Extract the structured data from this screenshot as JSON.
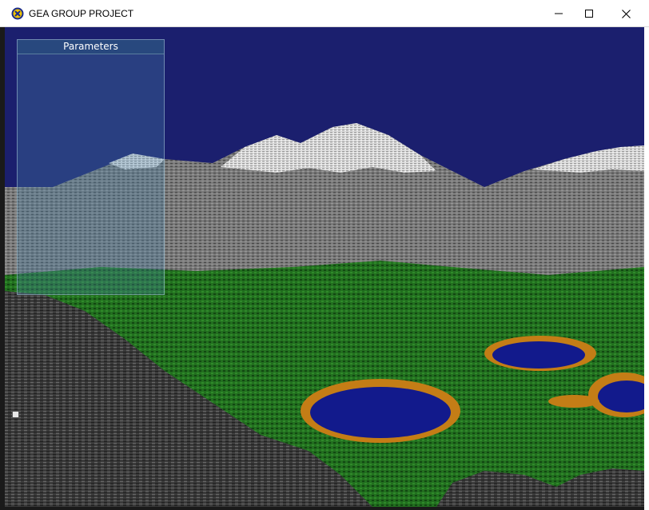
{
  "window": {
    "title": "GEA GROUP PROJECT",
    "icon": "app-logo-icon",
    "controls": [
      "minimize-icon",
      "maximize-icon",
      "close-icon"
    ]
  },
  "panel": {
    "title": "Parameters"
  },
  "scene": {
    "sky_color": "#1b1f6e",
    "grass_color": "#1f6a1c",
    "water_color": "#121a8c",
    "shore_color": "#c47d16",
    "snow_color": "#e8e8e8",
    "rock_color": "#6c6c6c"
  },
  "help_icon": "help-icon"
}
